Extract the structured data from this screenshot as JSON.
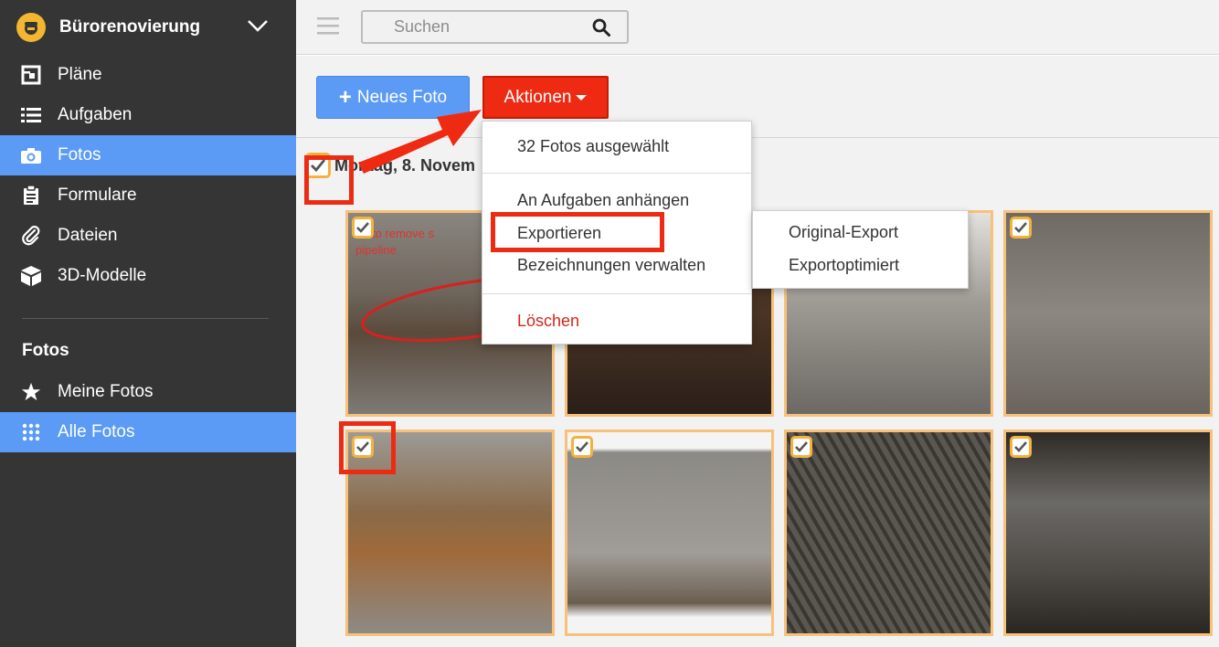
{
  "sidebar": {
    "project_name": "Bürorenovierung",
    "nav": [
      {
        "label": "Pläne"
      },
      {
        "label": "Aufgaben"
      },
      {
        "label": "Fotos"
      },
      {
        "label": "Formulare"
      },
      {
        "label": "Dateien"
      },
      {
        "label": "3D-Modelle"
      }
    ],
    "section_title": "Fotos",
    "sub_nav": [
      {
        "label": "Meine Fotos"
      },
      {
        "label": "Alle Fotos"
      }
    ]
  },
  "topbar": {
    "search_placeholder": "Suchen"
  },
  "toolbar": {
    "new_photo": "Neues Foto",
    "actions": "Aktionen"
  },
  "group": {
    "date": "Montag, 8. Novem"
  },
  "photos": {
    "annotation_text": "ed to remove s",
    "annotation_text2": "pipeline"
  },
  "dropdown": {
    "selected_count": "32 Fotos ausgewählt",
    "attach": "An Aufgaben anhängen",
    "export": "Exportieren",
    "manage_labels": "Bezeichnungen verwalten",
    "delete": "Löschen"
  },
  "submenu": {
    "original": "Original-Export",
    "optimized": "Exportoptimiert"
  },
  "colors": {
    "accent_blue": "#5b9bf5",
    "action_red": "#ee2a12",
    "highlight_red": "#ec2b12",
    "selection_orange": "#f5b13d",
    "sidebar_bg": "#353535"
  }
}
